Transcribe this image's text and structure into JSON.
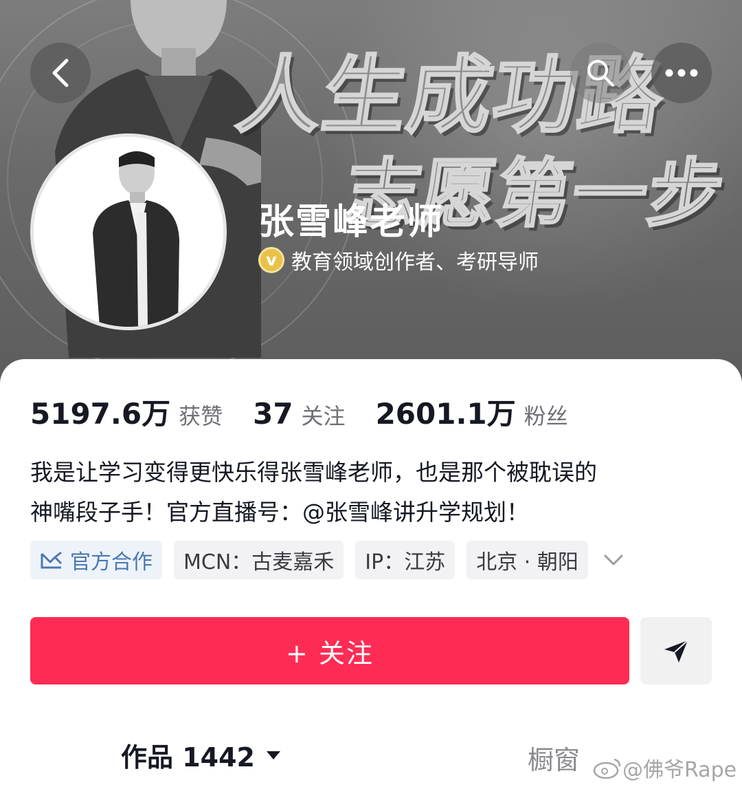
{
  "header": {
    "slogan_line1": "人生成功路",
    "slogan_line2": "志愿第一步",
    "icons": [
      "back-arrow-icon",
      "search-icon",
      "more-icon"
    ]
  },
  "profile": {
    "name": "张雪峰老师",
    "verification": "教育领域创作者、考研导师",
    "badge_letter": "v"
  },
  "stats": [
    {
      "value": "5197.6万",
      "label": "获赞"
    },
    {
      "value": "37",
      "label": "关注"
    },
    {
      "value": "2601.1万",
      "label": "粉丝"
    }
  ],
  "bio": {
    "line1": "我是让学习变得更快乐得张雪峰老师，也是那个被耽误的",
    "line2": "神嘴段子手！官方直播号：@张雪峰讲升学规划！"
  },
  "tags": {
    "official": "官方合作",
    "mcn": "MCN：古麦嘉禾",
    "ip": "IP：江苏",
    "location": "北京 · 朝阳"
  },
  "actions": {
    "follow": "+ 关注"
  },
  "tabs": {
    "works": "作品 1442",
    "shop": "橱窗"
  },
  "watermark": "@佛爷Rape",
  "colors": {
    "follow_button": "#fe2c55",
    "badge_gold": "#e9c24a",
    "official_tag_blue": "#4a78b3"
  }
}
